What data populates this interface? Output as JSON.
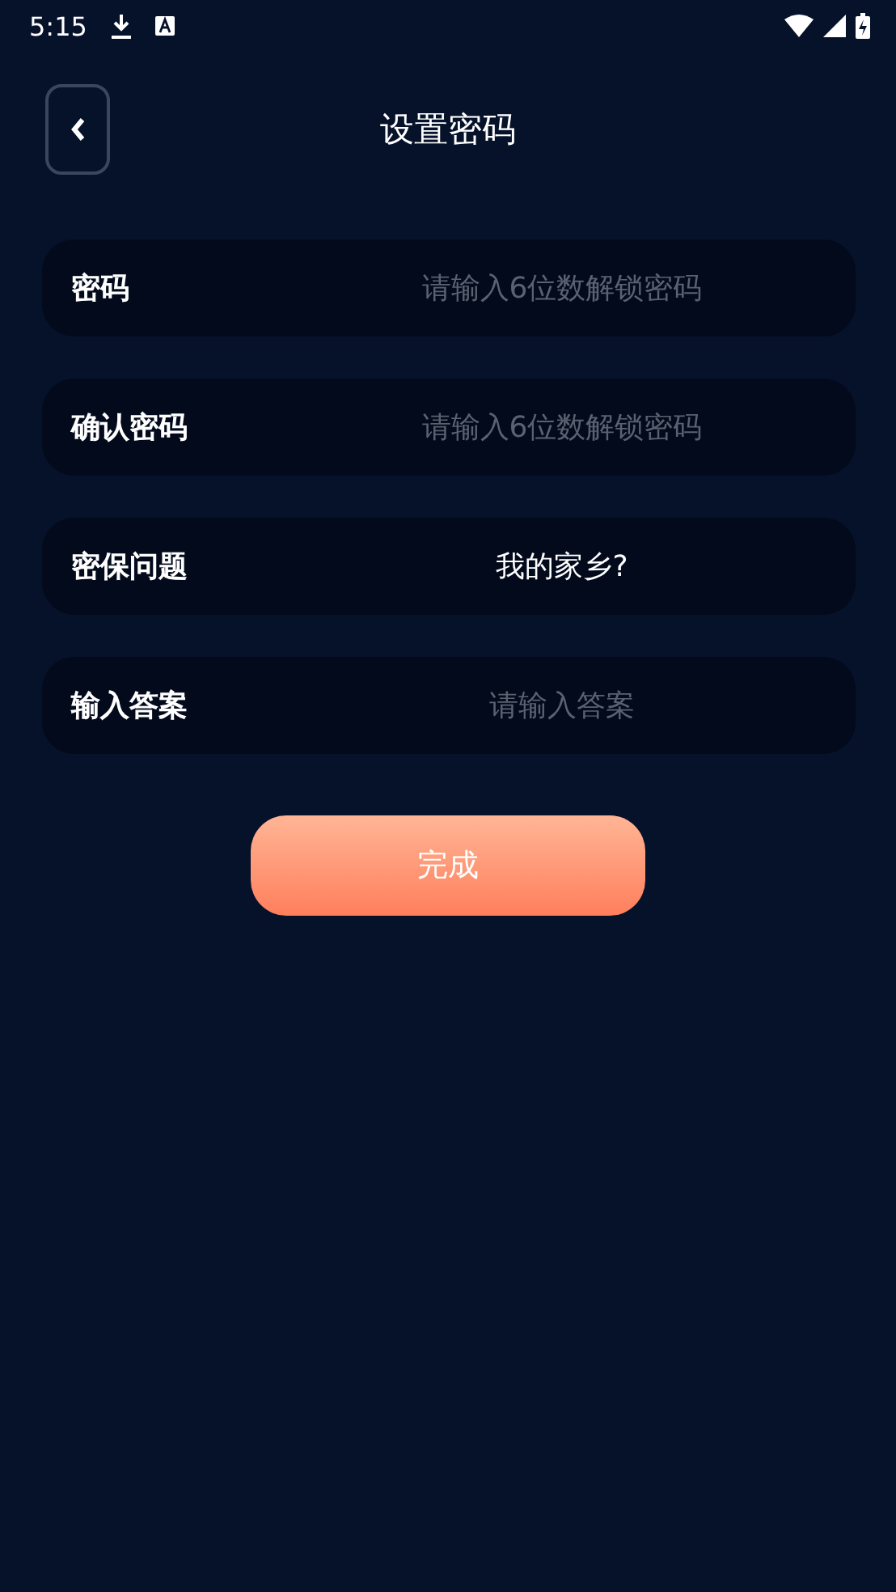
{
  "status_bar": {
    "time": "5:15"
  },
  "header": {
    "title": "设置密码"
  },
  "fields": [
    {
      "label": "密码",
      "placeholder": "请输入6位数解锁密码"
    },
    {
      "label": "确认密码",
      "placeholder": "请输入6位数解锁密码"
    },
    {
      "label": "密保问题",
      "value": "我的家乡?"
    },
    {
      "label": "输入答案",
      "placeholder": "请输入答案"
    }
  ],
  "submit_button": {
    "label": "完成"
  }
}
